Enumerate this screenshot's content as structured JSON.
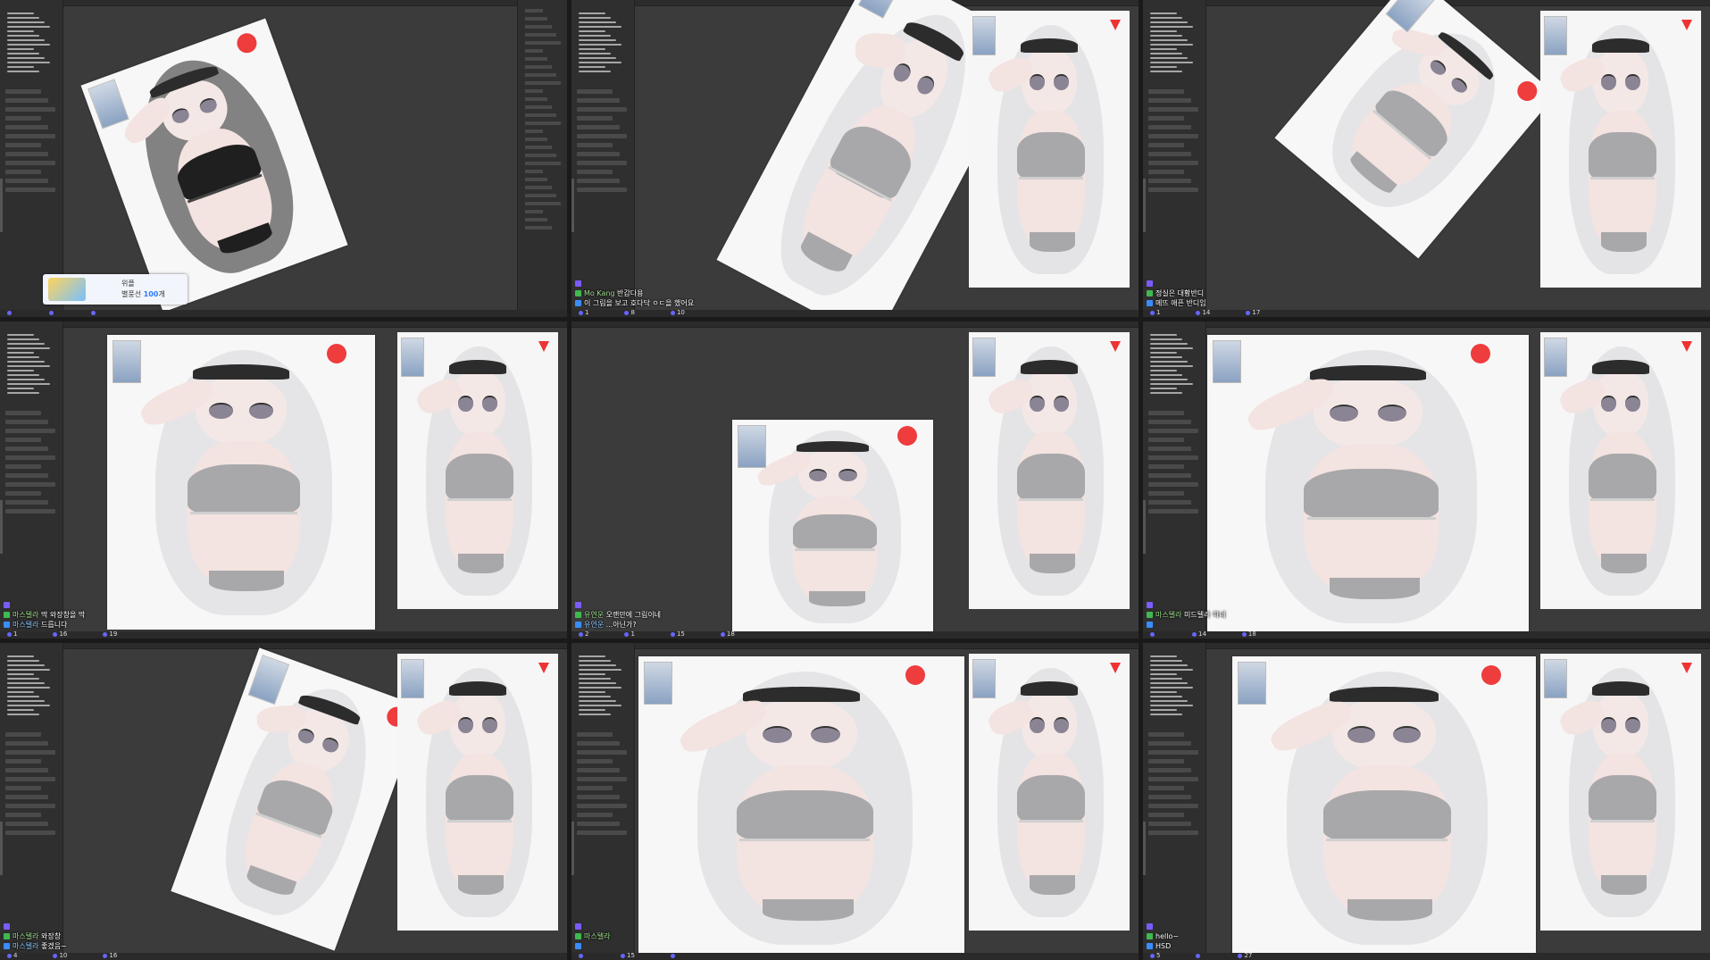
{
  "panels": [
    {
      "id": "p1",
      "donation": {
        "name": "위플",
        "amount_prefix": "별풍선 ",
        "amount": "100",
        "amount_suffix": "개"
      },
      "chat": [],
      "stats": [
        "",
        "",
        ""
      ]
    },
    {
      "id": "p2",
      "chat": [
        {
          "user": "",
          "text": ""
        },
        {
          "user": "Mo Kang",
          "text": "반갑다용"
        },
        {
          "user": "",
          "text": "이 그림을 보고 호다닥 ㅇㄷ을 했어요"
        }
      ],
      "stats": [
        "1",
        "8",
        "10"
      ]
    },
    {
      "id": "p3",
      "chat": [
        {
          "user": "",
          "text": ""
        },
        {
          "user": "",
          "text": "정실은 대황반디"
        },
        {
          "user": "",
          "text": "메뜨 애픈 반디임"
        }
      ],
      "stats": [
        "1",
        "14",
        "17"
      ]
    },
    {
      "id": "p4",
      "chat": [
        {
          "user": "",
          "text": ""
        },
        {
          "user": "마스텔라",
          "text": "딱 와장창을 딱"
        },
        {
          "user": "마스텔라",
          "text": "드릅니다"
        }
      ],
      "stats": [
        "1",
        "16",
        "19"
      ]
    },
    {
      "id": "p5",
      "chat": [
        {
          "user": "",
          "text": ""
        },
        {
          "user": "유연운",
          "text": "오랜만에 그림이네"
        },
        {
          "user": "유연운",
          "text": "...아닌가?"
        }
      ],
      "stats": [
        "2",
        "1",
        "15",
        "18"
      ]
    },
    {
      "id": "p6",
      "chat": [
        {
          "user": "",
          "text": ""
        },
        {
          "user": "마스텔라",
          "text": "미드텔라 하네"
        },
        {
          "user": "",
          "text": ""
        }
      ],
      "stats": [
        "",
        "14",
        "18"
      ]
    },
    {
      "id": "p7",
      "chat": [
        {
          "user": "",
          "text": ""
        },
        {
          "user": "마스텔라",
          "text": "와장창"
        },
        {
          "user": "마스텔라",
          "text": "좋겠음~"
        }
      ],
      "stats": [
        "4",
        "10",
        "16"
      ]
    },
    {
      "id": "p8",
      "chat": [
        {
          "user": "",
          "text": ""
        },
        {
          "user": "마스텔라",
          "text": ""
        },
        {
          "user": "",
          "text": ""
        }
      ],
      "stats": [
        "",
        "15",
        ""
      ]
    },
    {
      "id": "p9",
      "chat": [
        {
          "user": "",
          "text": ""
        },
        {
          "user": "",
          "text": "hello~"
        },
        {
          "user": "",
          "text": "HSD"
        }
      ],
      "stats": [
        "5",
        "",
        "27"
      ]
    }
  ],
  "colors": {
    "background": "#1a1a1a",
    "panel": "#3b3b3b",
    "toolbar": "#2f2f2f",
    "canvas": "#f7f7f7",
    "hair_dark": "#6d6d6d",
    "hair_light": "#e2e2e6",
    "top_black": "#1f1f1f",
    "top_gray": "#a8a8aa",
    "red_accent": "#ef3c3c",
    "donation_blue": "#2a7bff"
  },
  "icons": [
    "brush-icon",
    "heart-icon",
    "star-icon",
    "chat-badge-icon"
  ]
}
